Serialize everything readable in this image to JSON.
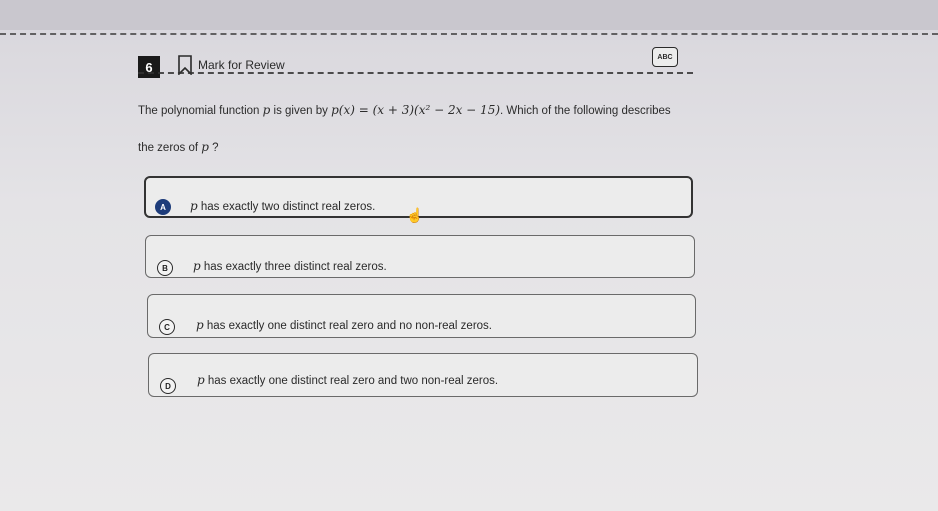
{
  "header": {
    "question_number": "6",
    "mark_for_review_label": "Mark for Review",
    "abc_label": "ABC"
  },
  "question": {
    "part1": "The polynomial function ",
    "var_p": "p",
    "part2": " is given by ",
    "formula": "p(x) = (x + 3)(x² − 2x − 15)",
    "part3": ". Which of the following describes",
    "part4": "the zeros of ",
    "var_p2": "p",
    "part5": " ?"
  },
  "choices": [
    {
      "letter": "A",
      "var": "p",
      "text": " has exactly two distinct real zeros."
    },
    {
      "letter": "B",
      "var": "p",
      "text": " has exactly three distinct real zeros."
    },
    {
      "letter": "C",
      "var": "p",
      "text": " has exactly one distinct real zero and no non-real zeros."
    },
    {
      "letter": "D",
      "var": "p",
      "text": " has exactly one distinct real zero and two non-real zeros."
    }
  ],
  "colors": {
    "selected_badge": "#1d3c7a"
  },
  "icons": {
    "bookmark": "bookmark-icon",
    "cursor": "hand-cursor-icon"
  }
}
